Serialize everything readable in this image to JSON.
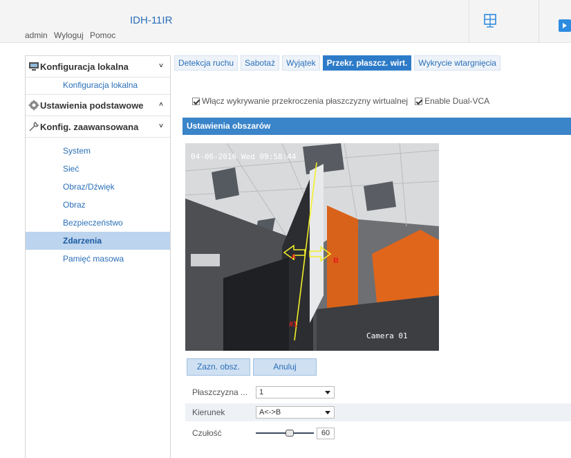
{
  "header": {
    "device_title": "IDH-11IR",
    "links": [
      "admin",
      "Wyloguj",
      "Pomoc"
    ],
    "icons": [
      "live-view-grid-icon",
      "playback-icon"
    ]
  },
  "sidebar": {
    "groups": [
      {
        "label": "Konfiguracja lokalna",
        "icon": "computer-icon",
        "chevron": "˅",
        "items": [
          "Konfiguracja lokalna"
        ]
      },
      {
        "label": "Ustawienia podstawowe",
        "icon": "gear-icon",
        "chevron": "˄",
        "items": []
      },
      {
        "label": "Konfig. zaawansowana",
        "icon": "wrench-icon",
        "chevron": "˅",
        "items": [
          "System",
          "Sieć",
          "Obraz/Dźwięk",
          "Obraz",
          "Bezpieczeństwo",
          "Zdarzenia",
          "Pamięć masowa"
        ]
      }
    ],
    "active_item": "Zdarzenia"
  },
  "tabs": {
    "items": [
      "Detekcja ruchu",
      "Sabotaż",
      "Wyjątek",
      "Przekr. płaszcz. wirt.",
      "Wykrycie wtargnięcia"
    ],
    "active": "Przekr. płaszcz. wirt."
  },
  "options": {
    "enable_line_crossing": {
      "label": "Włącz wykrywanie przekroczenia płaszczyzny wirtualnej",
      "checked": true
    },
    "enable_dual_vca": {
      "label": "Enable Dual-VCA",
      "checked": true
    }
  },
  "area_settings": {
    "title": "Ustawienia obszarów",
    "video": {
      "osd_date": "04-06-2016 Wed 09:58:44",
      "osd_camera": "Camera 01",
      "label_a": "A",
      "label_b": "B",
      "label_number": "#1"
    },
    "buttons": {
      "draw": "Zazn. obsz.",
      "cancel": "Anuluj"
    },
    "fields": {
      "plane": {
        "label": "Płaszczyzna ...",
        "value": "1"
      },
      "direction": {
        "label": "Kierunek",
        "value": "A<->B"
      },
      "sensitivity": {
        "label": "Czułość",
        "value": 60
      }
    }
  },
  "colors": {
    "accent": "#2d7bc8",
    "section_bar": "#3a84c9",
    "active_sidebar": "#bcd4ee",
    "link": "#2a6fb8",
    "crossing_line": "#f3f028",
    "marker_red": "#e41d1d"
  }
}
